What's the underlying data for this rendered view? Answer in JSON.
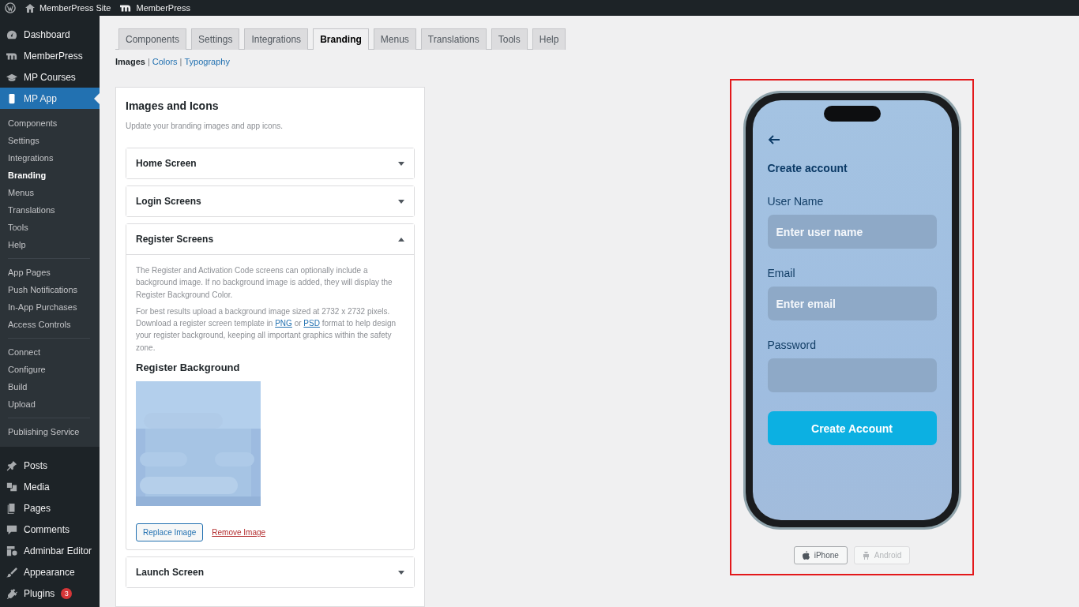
{
  "admin_bar": {
    "site": "MemberPress Site",
    "plugin": "MemberPress"
  },
  "sidebar": {
    "items": [
      {
        "label": "Dashboard",
        "selected": false
      },
      {
        "label": "MemberPress",
        "selected": false
      },
      {
        "label": "MP Courses",
        "selected": false
      },
      {
        "label": "MP App",
        "selected": true,
        "submenu": [
          [
            {
              "label": "Components",
              "selected": false
            },
            {
              "label": "Settings",
              "selected": false
            },
            {
              "label": "Integrations",
              "selected": false
            },
            {
              "label": "Branding",
              "selected": true
            },
            {
              "label": "Menus",
              "selected": false
            },
            {
              "label": "Translations",
              "selected": false
            },
            {
              "label": "Tools",
              "selected": false
            },
            {
              "label": "Help",
              "selected": false
            }
          ],
          [
            {
              "label": "App Pages",
              "selected": false
            },
            {
              "label": "Push Notifications",
              "selected": false
            },
            {
              "label": "In-App Purchases",
              "selected": false
            },
            {
              "label": "Access Controls",
              "selected": false
            }
          ],
          [
            {
              "label": "Connect",
              "selected": false
            },
            {
              "label": "Configure",
              "selected": false
            },
            {
              "label": "Build",
              "selected": false
            },
            {
              "label": "Upload",
              "selected": false
            }
          ],
          [
            {
              "label": "Publishing Service",
              "selected": false
            }
          ]
        ]
      },
      {
        "label": "Posts",
        "selected": false
      },
      {
        "label": "Media",
        "selected": false
      },
      {
        "label": "Pages",
        "selected": false
      },
      {
        "label": "Comments",
        "selected": false
      },
      {
        "label": "Adminbar Editor",
        "selected": false
      },
      {
        "label": "Appearance",
        "selected": false
      },
      {
        "label": "Plugins",
        "selected": false,
        "badge": "3"
      }
    ]
  },
  "tabs": [
    {
      "label": "Components",
      "selected": false
    },
    {
      "label": "Settings",
      "selected": false
    },
    {
      "label": "Integrations",
      "selected": false
    },
    {
      "label": "Branding",
      "selected": true
    },
    {
      "label": "Menus",
      "selected": false
    },
    {
      "label": "Translations",
      "selected": false
    },
    {
      "label": "Tools",
      "selected": false
    },
    {
      "label": "Help",
      "selected": false
    }
  ],
  "subnav": [
    {
      "label": "Images",
      "selected": true
    },
    {
      "separator": "|",
      "label": "Colors",
      "selected": false
    },
    {
      "separator": "|",
      "label": "Typography",
      "selected": false
    }
  ],
  "panel": {
    "title": "Images and Icons",
    "subtitle": "Update your branding images and app icons.",
    "sections": [
      {
        "title": "Home Screen",
        "expanded": false
      },
      {
        "title": "Login Screens",
        "expanded": false
      },
      {
        "title": "Register Screens",
        "expanded": true,
        "paragraphs": [
          [
            {
              "kind": "text",
              "text": "The Register and Activation Code screens can optionally include a background image. If no background image is added, they will display the Register Background Color."
            }
          ],
          [
            {
              "kind": "text",
              "text": "For best results upload a background image sized at 2732 x 2732 pixels. Download a register screen template in "
            },
            {
              "kind": "link",
              "text": "PNG"
            },
            {
              "kind": "text",
              "text": " or "
            },
            {
              "kind": "link",
              "text": "PSD"
            },
            {
              "kind": "text",
              "text": " format to help design your register background, keeping all important graphics within the safety zone."
            }
          ]
        ],
        "image_title": "Register Background",
        "image": {
          "kind": "picture"
        },
        "replace_button": "Replace Image",
        "remove_link": "Remove Image"
      },
      {
        "title": "Launch Screen",
        "expanded": false
      }
    ]
  },
  "preview": {
    "screen": {
      "title": "Create account",
      "fields": [
        {
          "label": "User Name",
          "placeholder": "Enter user name"
        },
        {
          "label": "Email",
          "placeholder": "Enter email"
        },
        {
          "label": "Password"
        }
      ],
      "button": "Create Account"
    },
    "devices": [
      {
        "label": "iPhone",
        "selected": true
      },
      {
        "label": "Android",
        "selected": false
      }
    ]
  }
}
